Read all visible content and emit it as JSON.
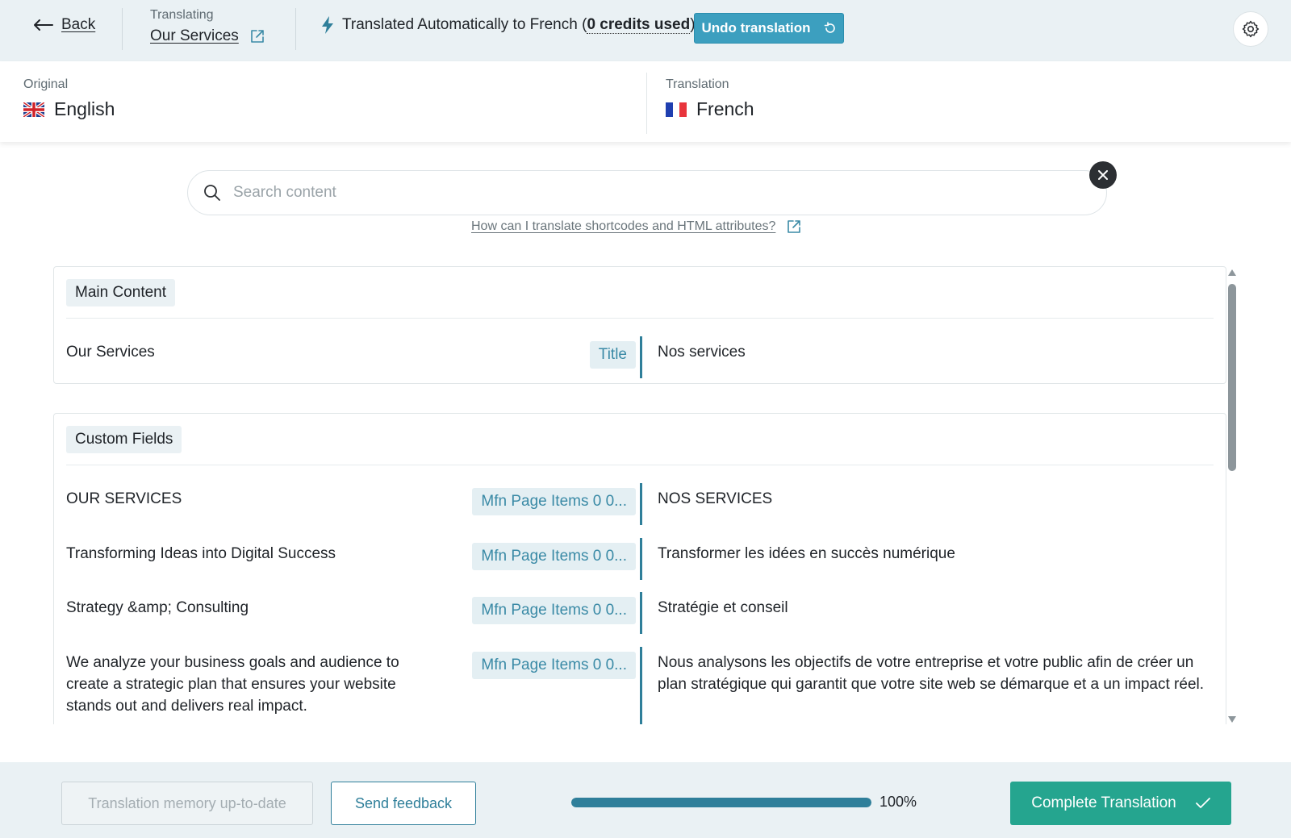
{
  "header": {
    "back_label": "Back",
    "translating_label": "Translating",
    "page_title": "Our Services",
    "auto_text_prefix": "Translated Automatically to French (",
    "credits_text": "0 credits used",
    "auto_text_suffix": ")",
    "undo_label": "Undo translation"
  },
  "languages": {
    "original_label": "Original",
    "original_name": "English",
    "translation_label": "Translation",
    "translation_name": "French"
  },
  "search": {
    "placeholder": "Search content",
    "help_link": "How can I translate shortcodes and HTML attributes?"
  },
  "sections": [
    {
      "title": "Main Content",
      "rows": [
        {
          "original": "Our Services",
          "tag": "Title",
          "translation": "Nos services"
        }
      ]
    },
    {
      "title": "Custom Fields",
      "rows": [
        {
          "original": "OUR SERVICES",
          "tag": "Mfn Page Items 0 0...",
          "translation": "NOS SERVICES"
        },
        {
          "original": "Transforming Ideas into Digital Success",
          "tag": "Mfn Page Items 0 0...",
          "translation": "Transformer les idées en succès numérique"
        },
        {
          "original": "Strategy &amp; Consulting",
          "tag": "Mfn Page Items 0 0...",
          "translation": "Stratégie et conseil"
        },
        {
          "original": "We analyze your business goals and audience to create a strategic plan that ensures your website stands out and delivers real impact.",
          "tag": "Mfn Page Items 0 0...",
          "translation": "Nous analysons les objectifs de votre entreprise et votre public afin de créer un plan stratégique qui garantit que votre site web se démarque et a un impact réel."
        }
      ]
    }
  ],
  "footer": {
    "memory_label": "Translation memory up-to-date",
    "feedback_label": "Send feedback",
    "progress_percent": 100,
    "progress_text": "100%",
    "complete_label": "Complete Translation"
  },
  "colors": {
    "accent": "#2f7f9a",
    "undo_button": "#3c9fbf",
    "complete_button": "#25a58f",
    "topbar_bg": "#eaf1f4"
  }
}
